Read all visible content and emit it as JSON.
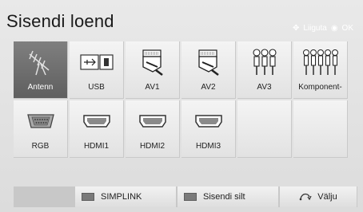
{
  "header": {
    "title": "Sisendi loend",
    "hint_move_icon": "move-arrows-icon",
    "hint_move_label": "Liiguta",
    "hint_ok_icon": "ok-circle-icon",
    "hint_ok_label": "OK"
  },
  "inputs": [
    {
      "label": "Antenn",
      "icon": "antenna-icon",
      "selected": true
    },
    {
      "label": "USB",
      "icon": "usb-icon",
      "selected": false
    },
    {
      "label": "AV1",
      "icon": "scart-icon",
      "selected": false
    },
    {
      "label": "AV2",
      "icon": "scart-icon",
      "selected": false
    },
    {
      "label": "AV3",
      "icon": "rca-connector-icon",
      "selected": false
    },
    {
      "label": "Komponent-",
      "icon": "component-connector-icon",
      "selected": false
    },
    {
      "label": "RGB",
      "icon": "vga-port-icon",
      "selected": false
    },
    {
      "label": "HDMI1",
      "icon": "hdmi-port-icon",
      "selected": false
    },
    {
      "label": "HDMI2",
      "icon": "hdmi-port-icon",
      "selected": false
    },
    {
      "label": "HDMI3",
      "icon": "hdmi-port-icon",
      "selected": false
    },
    {
      "label": "",
      "icon": "",
      "selected": false
    },
    {
      "label": "",
      "icon": "",
      "selected": false
    }
  ],
  "footer": {
    "simplink_label": "SIMPLINK",
    "input_label_label": "Sisendi silt",
    "exit_label": "Välju",
    "exit_icon": "return-arrow-icon"
  }
}
